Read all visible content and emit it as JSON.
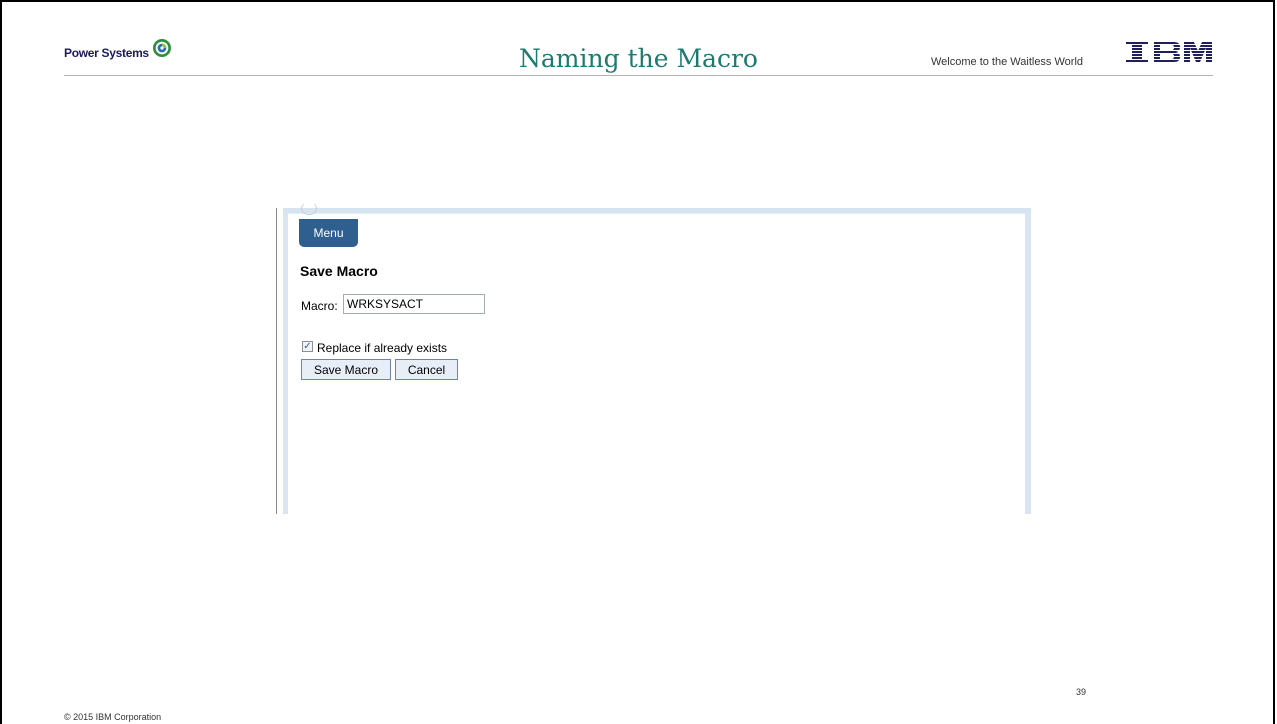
{
  "header": {
    "brand": "Power Systems",
    "brand_icon": "power-systems-swirl-icon",
    "title": "Naming the Macro",
    "tagline": "Welcome to the Waitless World",
    "ibm_logo": "IBM"
  },
  "screenshot": {
    "menu_label": "Menu",
    "heading": "Save Macro",
    "macro_label": "Macro:",
    "macro_value": "WRKSYSACT",
    "replace_checked": true,
    "replace_label": "Replace if already exists",
    "save_button": "Save Macro",
    "cancel_button": "Cancel",
    "colors": {
      "menu_tab": "#2e5f8f",
      "frame_rail": "#d9e5f2"
    }
  },
  "footer": {
    "page_number": "39",
    "copyright": "© 2015 IBM Corporation"
  }
}
